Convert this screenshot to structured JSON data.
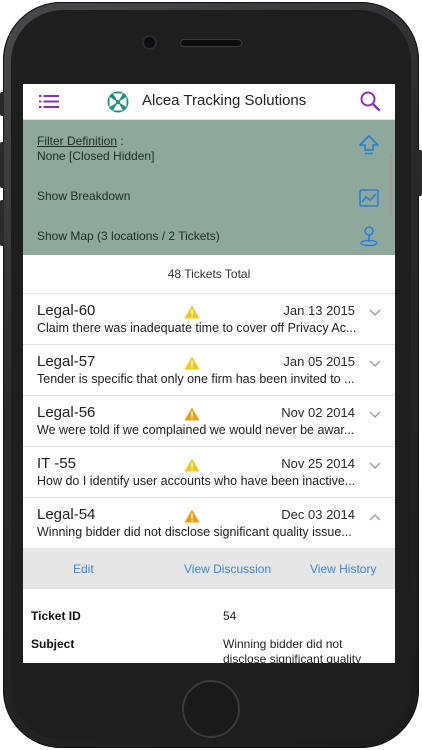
{
  "app": {
    "title": "Alcea Tracking Solutions"
  },
  "filter": {
    "label": "Filter Definition",
    "colon": " :",
    "value": "None [Closed Hidden]",
    "breakdown": "Show Breakdown",
    "map": "Show Map (3 locations / 2 Tickets)"
  },
  "summary": {
    "total": "48 Tickets Total"
  },
  "tickets": [
    {
      "id": "Legal-60",
      "date": "Jan 13 2015",
      "desc": "Claim there was inadequate time to cover off Privacy Ac...",
      "warn_color": "#f5c518",
      "chevron": "chevron-down-icon"
    },
    {
      "id": "Legal-57",
      "date": "Jan 05 2015",
      "desc": "Tender is specific that only one firm has been invited to ...",
      "warn_color": "#f5c518",
      "chevron": "chevron-down-icon"
    },
    {
      "id": "Legal-56",
      "date": "Nov 02 2014",
      "desc": "We were told if we complained we would never be awar...",
      "warn_color": "#f39c12",
      "chevron": "chevron-down-icon"
    },
    {
      "id": "IT -55",
      "date": "Nov 25 2014",
      "desc": "How do I identify user accounts who have been inactive...",
      "warn_color": "#f5c518",
      "chevron": "chevron-down-icon"
    },
    {
      "id": "Legal-54",
      "date": "Dec 03 2014",
      "desc": "Winning bidder did not disclose significant quality issue...",
      "warn_color": "#f39c12",
      "chevron": "chevron-up-icon"
    }
  ],
  "actions": {
    "edit": "Edit",
    "discussion": "View Discussion",
    "history": "View History"
  },
  "details": {
    "ticket_id_label": "Ticket ID",
    "ticket_id_value": "54",
    "subject_label": "Subject",
    "subject_value": "Winning bidder did not disclose significant quality"
  },
  "colors": {
    "accent": "#3d87d9",
    "panel": "#8ea89b",
    "menu": "#8e2fb0"
  }
}
